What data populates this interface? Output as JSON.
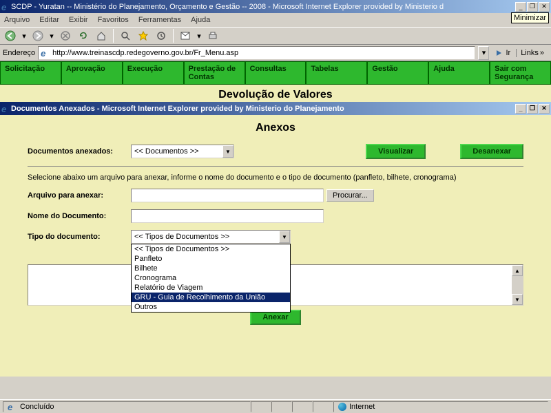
{
  "main_window": {
    "title": "SCDP - Yuratan -- Ministério do Planejamento, Orçamento e Gestão -- 2008 - Microsoft Internet Explorer provided by Ministerio d",
    "minimize_tooltip": "Minimizar"
  },
  "menubar": {
    "items": [
      "Arquivo",
      "Editar",
      "Exibir",
      "Favoritos",
      "Ferramentas",
      "Ajuda"
    ]
  },
  "addressbar": {
    "label": "Endereço",
    "url": "http://www.treinascdp.redegoverno.gov.br/Fr_Menu.asp",
    "go": "Ir",
    "links": "Links"
  },
  "navtabs": [
    "Solicitação",
    "Aprovação",
    "Execução",
    "Prestação de Contas",
    "Consultas",
    "Tabelas",
    "Gestão",
    "Ajuda",
    "Sair com Segurança"
  ],
  "page_title": "Devolução de Valores",
  "popup": {
    "title": "Documentos Anexados - Microsoft Internet Explorer provided by Ministerio do Planejamento",
    "heading": "Anexos",
    "docs_label": "Documentos anexados:",
    "docs_select": "<< Documentos >>",
    "visualizar": "Visualizar",
    "desanexar": "Desanexar",
    "instruction": "Selecione abaixo um arquivo para anexar, informe o nome do documento e o tipo de documento (panfleto, bilhete, cronograma)",
    "arquivo_label": "Arquivo para anexar:",
    "procurar": "Procurar...",
    "nome_label": "Nome do Documento:",
    "tipo_label": "Tipo do documento:",
    "tipo_select": "<< Tipos de Documentos >>",
    "tipo_options": [
      "<< Tipos de Documentos >>",
      "Panfleto",
      "Bilhete",
      "Cronograma",
      "Relatório de Viagem",
      "GRU - Guia de Recolhimento da União",
      "Outros"
    ],
    "selected_option_index": 5,
    "anexar": "Anexar"
  },
  "statusbar": {
    "status": "Concluído",
    "zone": "Internet"
  }
}
